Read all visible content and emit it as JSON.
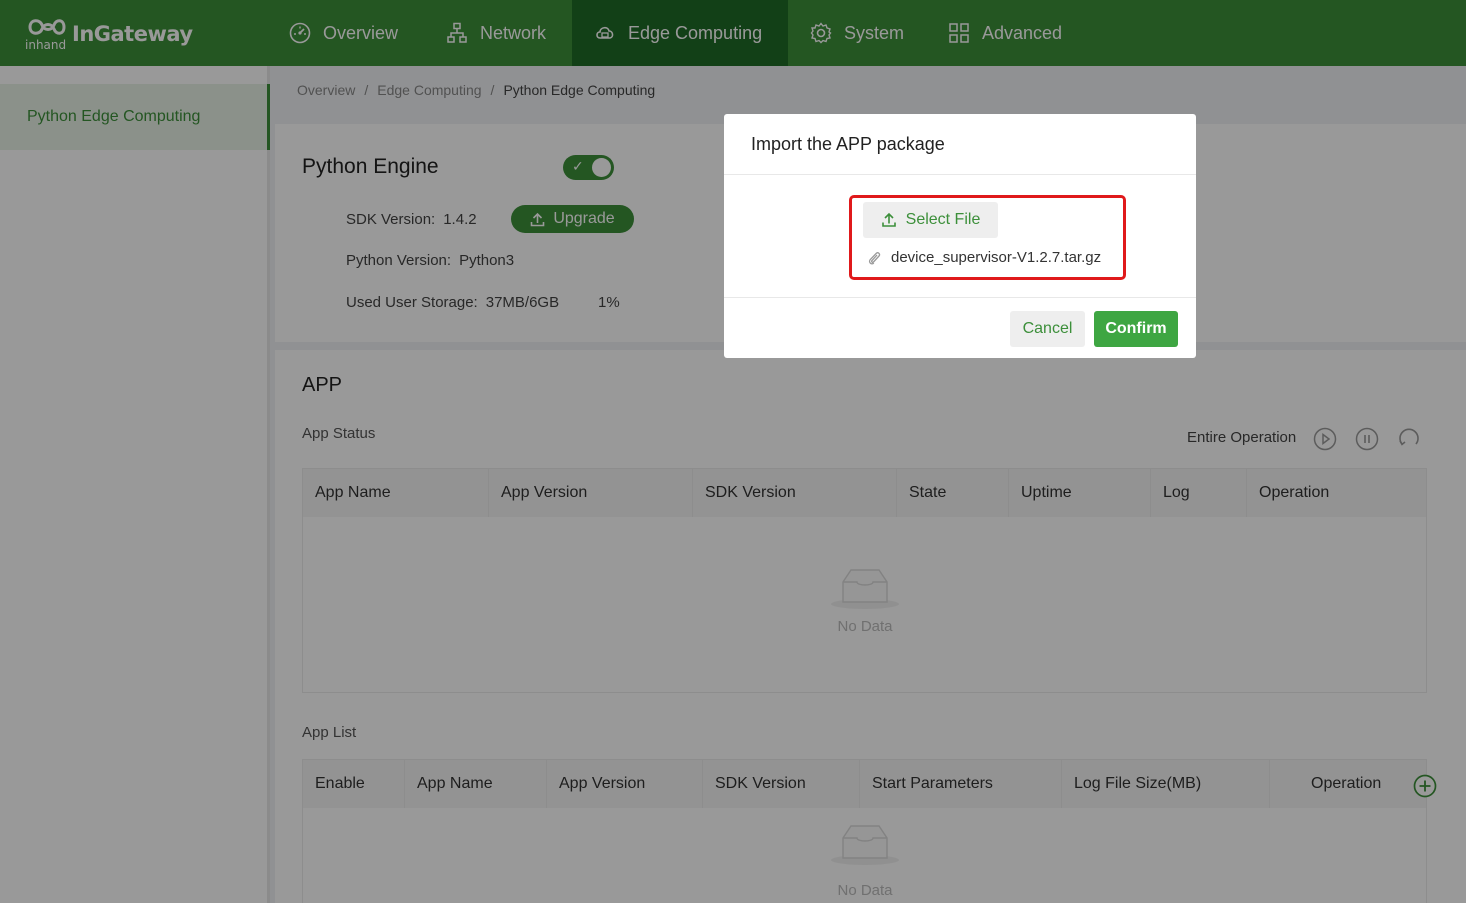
{
  "app": {
    "logo_text": "InGateway",
    "logo_sub": "inhand"
  },
  "nav": {
    "items": [
      {
        "label": "Overview",
        "icon": "dashboard-icon"
      },
      {
        "label": "Network",
        "icon": "network-icon"
      },
      {
        "label": "Edge Computing",
        "icon": "cloud-icon",
        "active": true
      },
      {
        "label": "System",
        "icon": "gear-icon"
      },
      {
        "label": "Advanced",
        "icon": "grid-icon"
      }
    ]
  },
  "sidebar": {
    "items": [
      {
        "label": "Python Edge Computing",
        "active": true
      }
    ]
  },
  "breadcrumb": [
    "Overview",
    "Edge Computing",
    "Python Edge Computing"
  ],
  "engine": {
    "title": "Python Engine",
    "enabled": true,
    "sdk_label": "SDK Version:",
    "sdk_value": "1.4.2",
    "upgrade_label": "Upgrade",
    "python_label": "Python Version:",
    "python_value": "Python3",
    "storage_label": "Used User Storage:",
    "storage_value": "37MB/6GB",
    "storage_percent": "1%"
  },
  "app_section": {
    "title": "APP",
    "status_title": "App Status",
    "entire_operation": "Entire Operation",
    "status_columns": [
      "App Name",
      "App Version",
      "SDK Version",
      "State",
      "Uptime",
      "Log",
      "Operation"
    ],
    "list_title": "App List",
    "list_columns": [
      "Enable",
      "App Name",
      "App Version",
      "SDK Version",
      "Start Parameters",
      "Log File Size(MB)",
      "Operation"
    ],
    "empty_text": "No Data"
  },
  "modal": {
    "title": "Import the APP package",
    "select_label": "Select File",
    "file_name": "device_supervisor-V1.2.7.tar.gz",
    "cancel_label": "Cancel",
    "confirm_label": "Confirm"
  },
  "colors": {
    "brand": "#3c8f3a",
    "brand_dark": "#1f6b27",
    "confirm": "#3ea642",
    "highlight": "#e0191b"
  }
}
